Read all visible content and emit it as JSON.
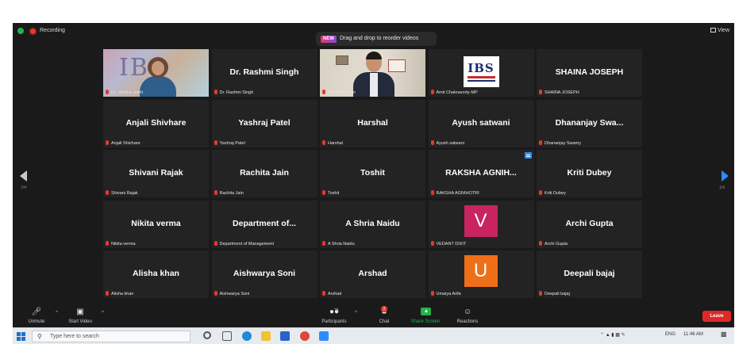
{
  "topbar": {
    "recording_label": "Recording",
    "view_label": "View"
  },
  "banner": {
    "new_tag": "NEW",
    "message": "Drag and drop to reorder videos"
  },
  "pager": {
    "left": "1/4",
    "right": "1/4"
  },
  "participants": [
    {
      "display": "",
      "label": "Dr. Varsha Joshi",
      "kind": "video-joshi",
      "active": true
    },
    {
      "display": "Dr. Rashmi Singh",
      "label": "Dr. Rashmi Singh",
      "kind": "name"
    },
    {
      "display": "",
      "label": "Zeeshan khan",
      "kind": "video-khan"
    },
    {
      "display": "IBS",
      "label": "Amit Chakravorty-MP",
      "kind": "logo"
    },
    {
      "display": "SHAINA JOSEPH",
      "label": "SHAINA JOSEPH",
      "kind": "name"
    },
    {
      "display": "Anjali Shivhare",
      "label": "Anjali Shivhare",
      "kind": "name"
    },
    {
      "display": "Yashraj Patel",
      "label": "Yashraj Patel",
      "kind": "name"
    },
    {
      "display": "Harshal",
      "label": "Harshal",
      "kind": "name"
    },
    {
      "display": "Ayush satwani",
      "label": "Ayush satwani",
      "kind": "name"
    },
    {
      "display": "Dhananjay Swa...",
      "label": "Dhananjay Swamy",
      "kind": "name"
    },
    {
      "display": "Shivani Rajak",
      "label": "Shivani Rajak",
      "kind": "name"
    },
    {
      "display": "Rachita Jain",
      "label": "Rachita Jain",
      "kind": "name"
    },
    {
      "display": "Toshit",
      "label": "Toshit",
      "kind": "name"
    },
    {
      "display": "RAKSHA AGNIH...",
      "label": "RAKSHA AGNIHOTRI",
      "kind": "name",
      "badge": true
    },
    {
      "display": "Kriti Dubey",
      "label": "Kriti Dubey",
      "kind": "name"
    },
    {
      "display": "Nikita verma",
      "label": "Nikita verma",
      "kind": "name"
    },
    {
      "display": "Department of...",
      "label": "Department of Management",
      "kind": "name"
    },
    {
      "display": "A Shria Naidu",
      "label": "A Shria Naidu",
      "kind": "name"
    },
    {
      "display": "V",
      "label": "VEDANT DIXIT",
      "kind": "avatar",
      "color": "#c9245e"
    },
    {
      "display": "Archi Gupta",
      "label": "Archi Gupta",
      "kind": "name"
    },
    {
      "display": "Alisha khan",
      "label": "Alisha khan",
      "kind": "name"
    },
    {
      "display": "Aishwarya Soni",
      "label": "Aishwarya Soni",
      "kind": "name"
    },
    {
      "display": "Arshad",
      "label": "Arshad",
      "kind": "name"
    },
    {
      "display": "U",
      "label": "Umaiya Arifa",
      "kind": "avatar",
      "color": "#ef6f18"
    },
    {
      "display": "Deepali bajaj",
      "label": "Deepali bajaj",
      "kind": "name"
    }
  ],
  "toolbar": {
    "unmute": "Unmute",
    "start_video": "Start Video",
    "participants": "Participants",
    "participants_count": "75",
    "chat": "Chat",
    "chat_badge": "2",
    "share_screen": "Share Screen",
    "reactions": "Reactions",
    "leave": "Leave"
  },
  "taskbar": {
    "search_placeholder": "Type here to search",
    "language": "ENG",
    "time": "11:46 AM"
  },
  "colors": {
    "mute_red": "#e23b2e",
    "active_border": "#d9d23a",
    "share_green": "#23b24b",
    "leave_red": "#e02828",
    "accent_blue": "#2d8cff"
  }
}
